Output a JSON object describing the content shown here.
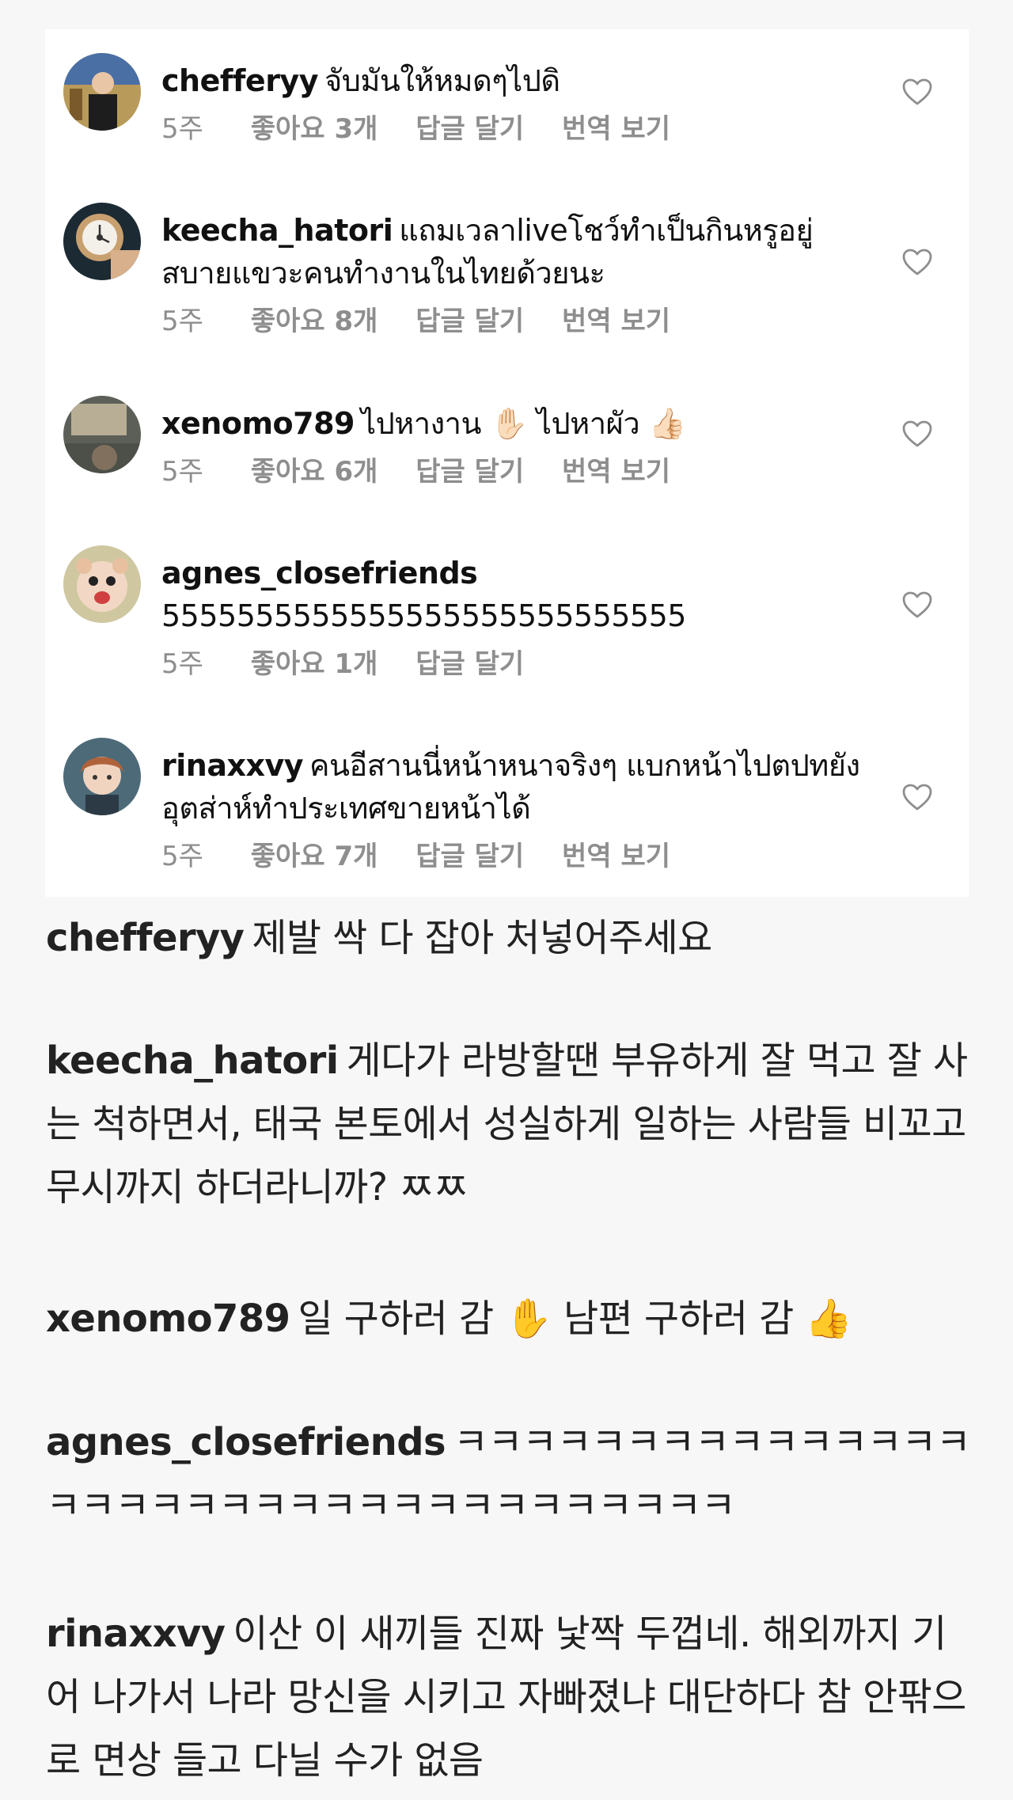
{
  "comments": [
    {
      "username": "chefferyy",
      "text": "จับมันให้หมดๆไปดิ",
      "age": "5주",
      "likes": "좋아요 3개",
      "reply": "답글 달기",
      "translate": "번역 보기"
    },
    {
      "username": "keecha_hatori",
      "text": "แถมเวลาliveโชว์ทำเป็นกินหรูอยู่สบายแขวะคนทำงานในไทยด้วยนะ",
      "age": "5주",
      "likes": "좋아요 8개",
      "reply": "답글 달기",
      "translate": "번역 보기"
    },
    {
      "username": "xenomo789",
      "text": "ไปหางาน ✋🏻 ไปหาผัว 👍🏻",
      "age": "5주",
      "likes": "좋아요 6개",
      "reply": "답글 달기",
      "translate": "번역 보기"
    },
    {
      "username": "agnes_closefriends",
      "text": " 5555555555555555555555555555",
      "age": "5주",
      "likes": "좋아요 1개",
      "reply": "답글 달기",
      "translate": ""
    },
    {
      "username": "rinaxxvy",
      "text": "คนอีสานนี่หน้าหนาจริงๆ แบกหน้าไปตปทยังอุตส่าห์ทำประเทศขายหน้าได้",
      "age": "5주",
      "likes": "좋아요 7개",
      "reply": "답글 달기",
      "translate": "번역 보기"
    }
  ],
  "translations": [
    {
      "username": "chefferyy",
      "text": "제발 싹 다 잡아 처넣어주세요"
    },
    {
      "username": "keecha_hatori",
      "text": "게다가 라방할땐 부유하게 잘 먹고 잘 사는 척하면서, 태국 본토에서 성실하게 일하는 사람들 비꼬고 무시까지 하더라니까? ㅉㅉ"
    },
    {
      "username": "xenomo789",
      "text": "일 구하러 감 ✋ 남편 구하러 감 👍"
    },
    {
      "username": "agnes_closefriends",
      "text": "ㅋㅋㅋㅋㅋㅋㅋㅋㅋㅋㅋㅋㅋㅋㅋㅋㅋㅋㅋㅋㅋㅋㅋㅋㅋㅋㅋㅋㅋㅋㅋㅋㅋㅋㅋ"
    },
    {
      "username": "rinaxxvy",
      "text": "이산 이 새끼들 진짜 낯짝 두껍네. 해외까지 기어 나가서 나라 망신을 시키고 자빠졌냐 대단하다 참 안팎으로 면상 들고 다닐 수가 없음"
    }
  ],
  "colors": {
    "meta": "#8e8e8e",
    "card": "#ffffff",
    "background": "#f7f7f8"
  }
}
